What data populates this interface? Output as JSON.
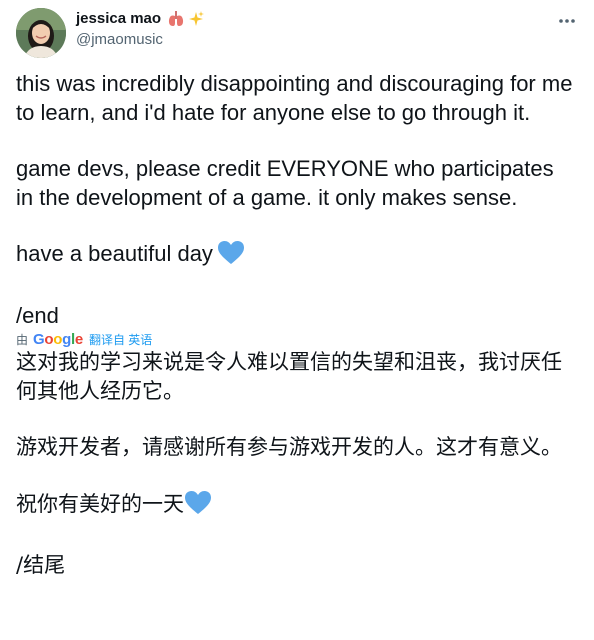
{
  "user": {
    "display_name": "jessica mao",
    "handle": "@jmaomusic",
    "avatar": "avatar-photo",
    "name_emojis": [
      "lungs-emoji",
      "sparkles-emoji"
    ]
  },
  "menu": {
    "more_icon": "more-horizontal-icon"
  },
  "tweet": {
    "p1": "this was incredibly disappointing and discouraging for me to learn, and i'd hate for anyone else to go through it.",
    "p2": "game devs, please credit EVERYONE who participates in the development of a game. it only makes sense.",
    "p3": "have a beautiful day",
    "p4": "/end",
    "heart_emoji": "blue-heart-emoji"
  },
  "translation": {
    "by_label": "由",
    "provider": "Google",
    "action_label": "翻译自 英语",
    "p1": "这对我的学习来说是令人难以置信的失望和沮丧，我讨厌任何其他人经历它。",
    "p2": "游戏开发者，请感谢所有参与游戏开发的人。这才有意义。",
    "p3": "祝你有美好的一天",
    "p4": "/结尾"
  },
  "colors": {
    "text_primary": "#0f1419",
    "text_secondary": "#536471",
    "link_blue": "#1d9bf0",
    "heart_blue": "#5ba7ea"
  }
}
